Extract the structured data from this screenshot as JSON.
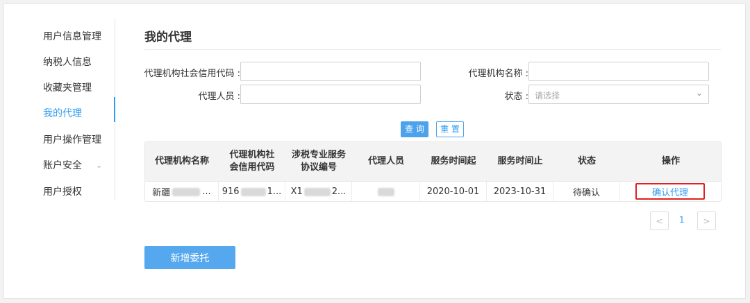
{
  "sidebar": {
    "items": [
      {
        "label": "用户信息管理"
      },
      {
        "label": "纳税人信息"
      },
      {
        "label": "收藏夹管理"
      },
      {
        "label": "我的代理"
      },
      {
        "label": "用户操作管理"
      },
      {
        "label": "账户安全"
      },
      {
        "label": "用户授权"
      }
    ],
    "active_index": 3
  },
  "page": {
    "title": "我的代理"
  },
  "form": {
    "credit_code_label": "代理机构社会信用代码 :",
    "credit_code_value": "",
    "org_name_label": "代理机构名称 :",
    "org_name_value": "",
    "agent_label": "代理人员 :",
    "agent_value": "",
    "status_label": "状态 :",
    "status_placeholder": "请选择",
    "query_button": "查 询",
    "reset_button": "重 置"
  },
  "table": {
    "headers": [
      "代理机构名称",
      "代理机构社会信用代码",
      "涉税专业服务协议编号",
      "代理人员",
      "服务时间起",
      "服务时间止",
      "状态",
      "操作"
    ],
    "rows": [
      {
        "org_name_visible": "新疆",
        "org_name_tail": "...",
        "credit_code_visible": "916",
        "credit_code_tail": "1...",
        "agreement_visible": "X1",
        "agreement_tail": "2...",
        "start": "2020-10-01",
        "end": "2023-10-31",
        "status": "待确认",
        "action": "确认代理"
      }
    ]
  },
  "pagination": {
    "current": "1",
    "prev": "<",
    "next": ">"
  },
  "new_button": "新增委托",
  "colors": {
    "accent": "#2f9bf0",
    "highlight_border": "#e02020"
  }
}
